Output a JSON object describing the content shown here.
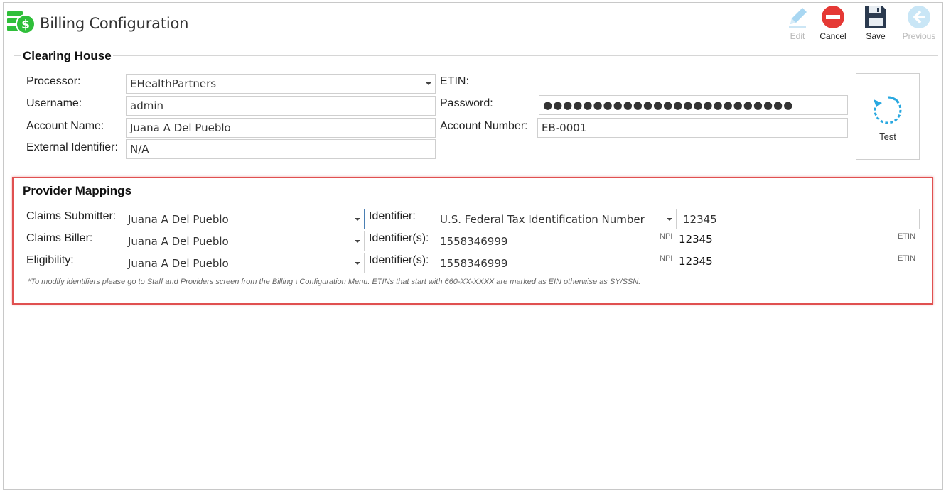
{
  "window": {
    "title": "Billing Configuration"
  },
  "toolbar": {
    "edit": {
      "label": "Edit",
      "icon": "pencil-icon",
      "enabled": false
    },
    "cancel": {
      "label": "Cancel",
      "icon": "cancel-icon",
      "enabled": true
    },
    "save": {
      "label": "Save",
      "icon": "floppy-disk-icon",
      "enabled": true
    },
    "previous": {
      "label": "Previous",
      "icon": "arrow-left-icon",
      "enabled": false
    }
  },
  "clearing_house": {
    "title": "Clearing House",
    "processor_label": "Processor:",
    "processor_value": "EHealthPartners",
    "etin_label": "ETIN:",
    "username_label": "Username:",
    "username_value": "admin",
    "password_label": "Password:",
    "password_value": "●●●●●●●●●●●●●●●●●●●●●●●●●",
    "account_name_label": "Account Name:",
    "account_name_value": "Juana A Del Pueblo",
    "account_number_label": "Account Number:",
    "account_number_value": "EB-0001",
    "external_identifier_label": "External Identifier:",
    "external_identifier_value": "N/A",
    "test_label": "Test"
  },
  "provider_mappings": {
    "title": "Provider Mappings",
    "claims_submitter_label": "Claims Submitter:",
    "claims_submitter_value": "Juana A Del Pueblo",
    "identifier_label": "Identifier:",
    "identifier_type_value": "U.S. Federal Tax Identification Number",
    "identifier_value": "12345",
    "claims_biller_label": "Claims Biller:",
    "claims_biller_value": "Juana A Del Pueblo",
    "biller_identifiers_label": "Identifier(s):",
    "biller_npi": "1558346999",
    "biller_etin": "12345",
    "eligibility_label": "Eligibility:",
    "eligibility_value": "Juana A Del Pueblo",
    "eligibility_identifiers_label": "Identifier(s):",
    "eligibility_npi": "1558346999",
    "eligibility_etin": "12345",
    "npi_tag": "NPI",
    "etin_tag": "ETIN",
    "note": "*To modify identifiers please go to Staff and Providers screen from the Billing \\ Configuration Menu. ETINs that start with 660-XX-XXXX are marked as EIN otherwise as SY/SSN."
  },
  "colors": {
    "brand_green": "#2fbf3a",
    "cancel_red": "#e53935",
    "save_navy": "#2b3a4f",
    "disabled_blue": "#9ed0ee",
    "test_blue": "#29a8e0",
    "highlight_red": "#e05050"
  }
}
